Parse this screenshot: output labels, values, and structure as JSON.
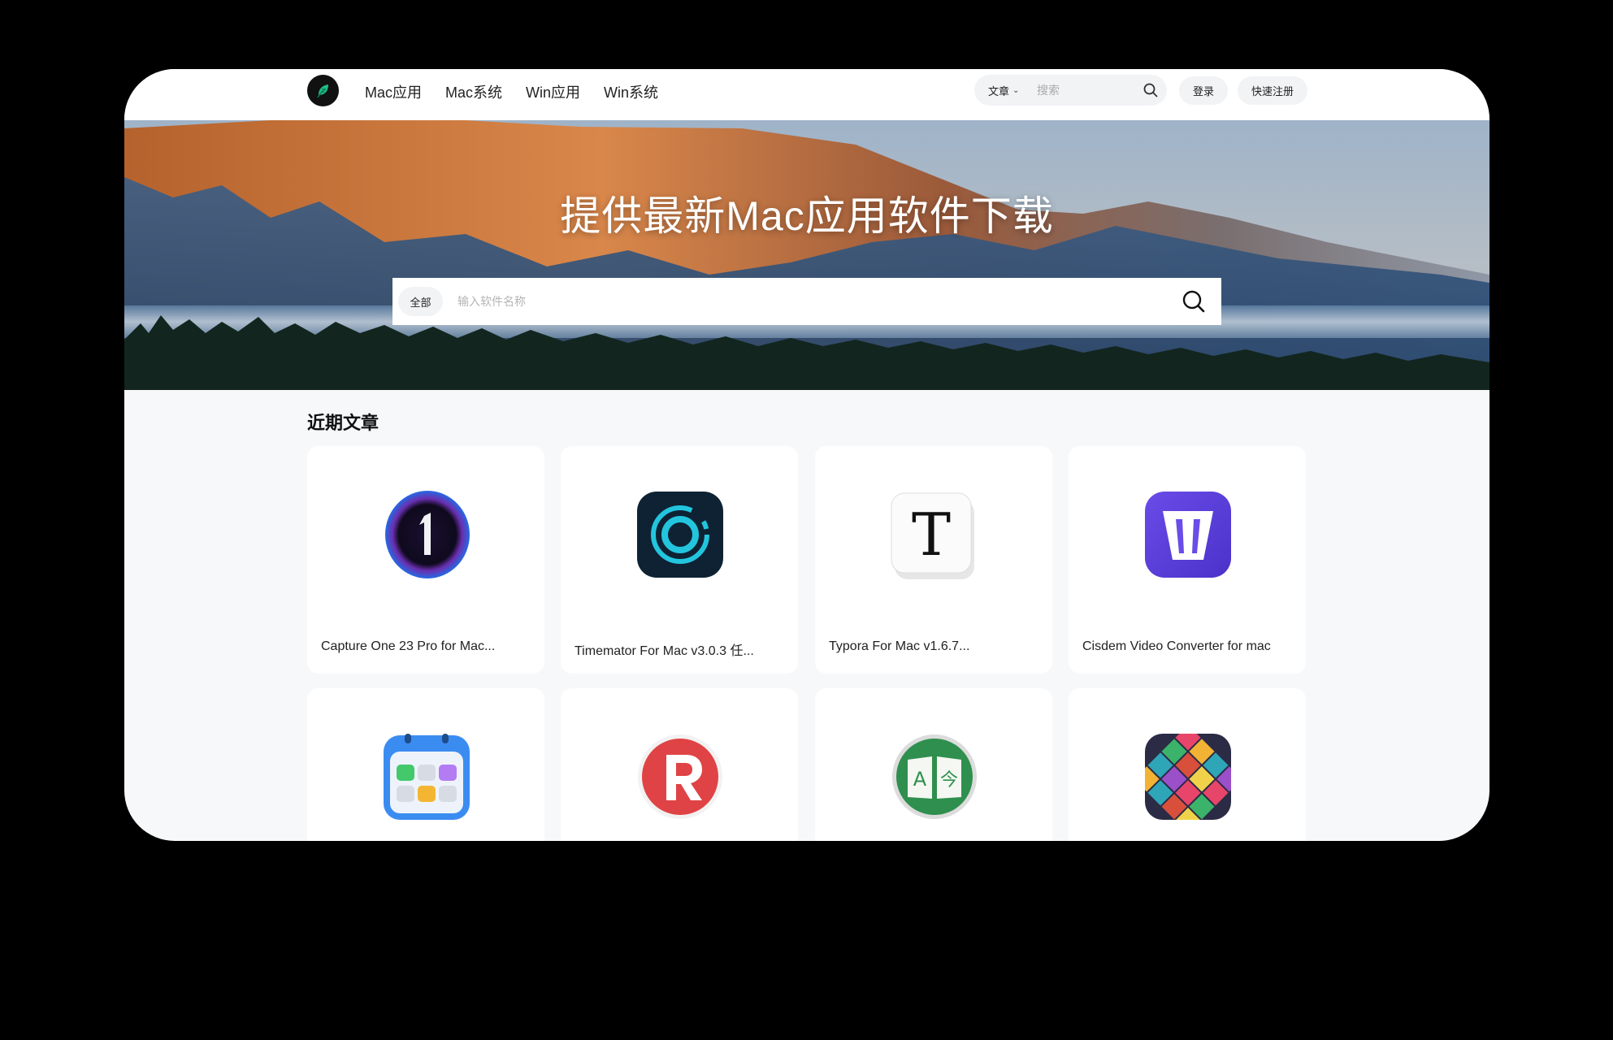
{
  "header": {
    "nav": [
      "Mac应用",
      "Mac系统",
      "Win应用",
      "Win系统"
    ],
    "search_type": "文章",
    "search_placeholder": "搜索",
    "login_label": "登录",
    "register_label": "快速注册"
  },
  "hero": {
    "title": "提供最新Mac应用软件下载",
    "scope_chip": "全部",
    "search_placeholder": "输入软件名称"
  },
  "section": {
    "title": "近期文章"
  },
  "cards": [
    {
      "title": "Capture One 23 Pro for Mac...",
      "icon": "capture-one-icon"
    },
    {
      "title": "Timemator For Mac v3.0.3 任...",
      "icon": "timemator-icon"
    },
    {
      "title": "Typora For Mac v1.6.7...",
      "icon": "typora-icon"
    },
    {
      "title": "Cisdem Video Converter for mac",
      "icon": "cisdem-video-converter-icon"
    },
    {
      "title": "",
      "icon": "calendar-app-icon"
    },
    {
      "title": "",
      "icon": "r-app-icon"
    },
    {
      "title": "",
      "icon": "translator-icon"
    },
    {
      "title": "",
      "icon": "pattern-app-icon"
    }
  ],
  "colors": {
    "accent_green": "#22c08a",
    "background": "#f7f8fa",
    "frame_outer": "#000000"
  }
}
